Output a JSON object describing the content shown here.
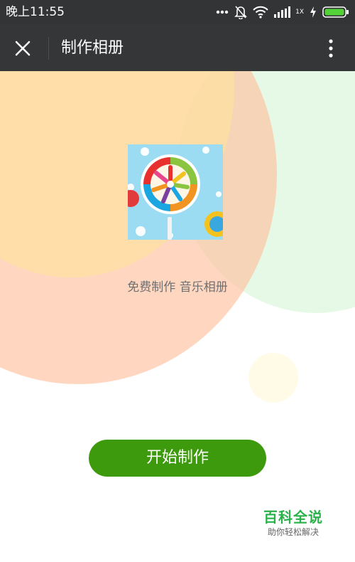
{
  "status_bar": {
    "time": "晚上11:55",
    "network_label": "1X",
    "icons": [
      "more-dots-icon",
      "bell-off-icon",
      "wifi-icon",
      "signal-bars-icon",
      "charging-icon",
      "battery-icon"
    ],
    "battery_color": "#53d23a"
  },
  "title_bar": {
    "title": "制作相册",
    "close_icon": "close-icon",
    "more_icon": "more-vertical-icon",
    "background": "#353638"
  },
  "main": {
    "album_cover_icon": "lollipop-image",
    "subtitle": "免费制作 音乐相册",
    "start_button_label": "开始制作",
    "start_button_color": "#3d9a0c"
  },
  "watermark": {
    "title": "百科全说",
    "subtitle": "助你轻松解决"
  }
}
